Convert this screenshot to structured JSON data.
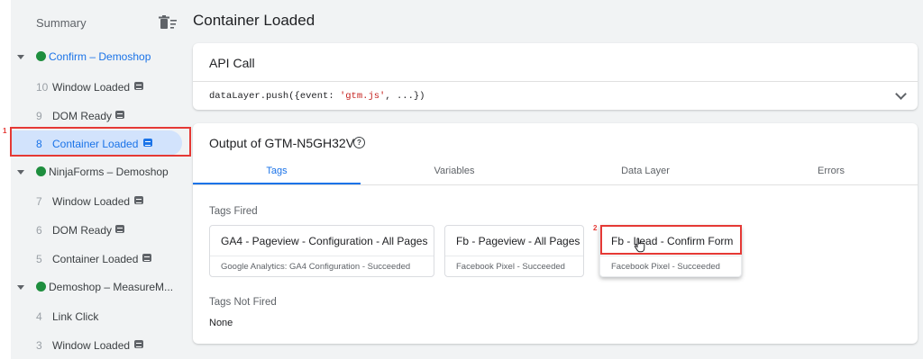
{
  "sidebar": {
    "summary_label": "Summary",
    "groups": [
      {
        "label": "Confirm – Demoshop",
        "status": "success"
      },
      {
        "label": "NinjaForms – Demoshop",
        "status": "success"
      },
      {
        "label": "Demoshop – MeasureM...",
        "status": "success"
      }
    ],
    "items": [
      {
        "num": "10",
        "label": "Window Loaded"
      },
      {
        "num": "9",
        "label": "DOM Ready"
      },
      {
        "num": "8",
        "label": "Container Loaded"
      },
      {
        "num": "7",
        "label": "Window Loaded"
      },
      {
        "num": "6",
        "label": "DOM Ready"
      },
      {
        "num": "5",
        "label": "Container Loaded"
      },
      {
        "num": "4",
        "label": "Link Click"
      },
      {
        "num": "3",
        "label": "Window Loaded"
      }
    ]
  },
  "annotations": {
    "box1": "1",
    "box2": "2",
    "color": "#e53935"
  },
  "main": {
    "title": "Container Loaded",
    "api_card": {
      "header": "API Call",
      "code_prefix": "dataLayer.push({event: ",
      "code_string": "'gtm.js'",
      "code_suffix": ", ...})"
    },
    "output_card": {
      "header": "Output of GTM-N5GH32V",
      "help_icon": "help-icon",
      "tabs": [
        "Tags",
        "Variables",
        "Data Layer",
        "Errors"
      ],
      "active_tab": "Tags",
      "tags_fired_label": "Tags Fired",
      "tags_fired": [
        {
          "name": "GA4 - Pageview - Configuration - All Pages",
          "detail": "Google Analytics: GA4 Configuration - Succeeded"
        },
        {
          "name": "Fb - Pageview - All Pages",
          "detail": "Facebook Pixel - Succeeded"
        },
        {
          "name": "Fb - Lead - Confirm Form",
          "detail": "Facebook Pixel - Succeeded"
        }
      ],
      "tags_not_fired_label": "Tags Not Fired",
      "tags_not_fired_value": "None"
    }
  },
  "colors": {
    "accent": "#1a73e8",
    "success": "#1e8e3e",
    "background": "#f1f3f4"
  }
}
